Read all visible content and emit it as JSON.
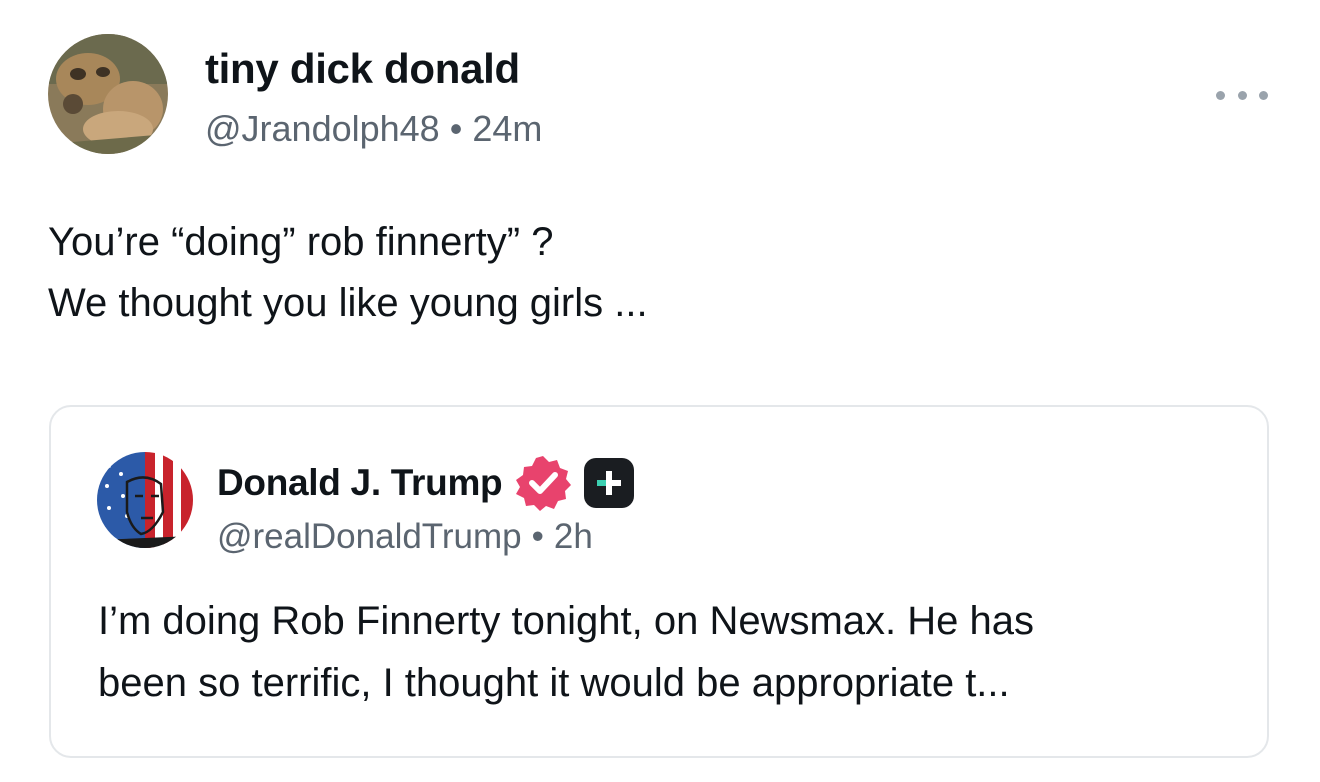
{
  "post": {
    "author": {
      "display_name": "tiny dick donald",
      "handle": "@Jrandolph48",
      "time": "24m",
      "avatar_icon": "hyena-photo-avatar"
    },
    "more_icon": "more-horizontal-icon",
    "text_lines": [
      "You’re “doing” rob finnerty” ?",
      "We thought you like young girls ..."
    ]
  },
  "quoted_post": {
    "author": {
      "display_name": "Donald J. Trump",
      "handle": "@realDonaldTrump",
      "time": "2h",
      "avatar_icon": "flag-face-avatar",
      "verified_icon": "verified-badge-icon",
      "plus_icon": "plus-subscription-icon"
    },
    "text_lines": [
      "I’m doing Rob Finnerty tonight, on Newsmax. He has",
      "been so terrific, I thought it would be appropriate t..."
    ]
  },
  "separator": "•",
  "colors": {
    "text": "#0f1419",
    "secondary": "#5b6570",
    "verified": "#e8436d",
    "card_border": "#e4e7ea"
  }
}
